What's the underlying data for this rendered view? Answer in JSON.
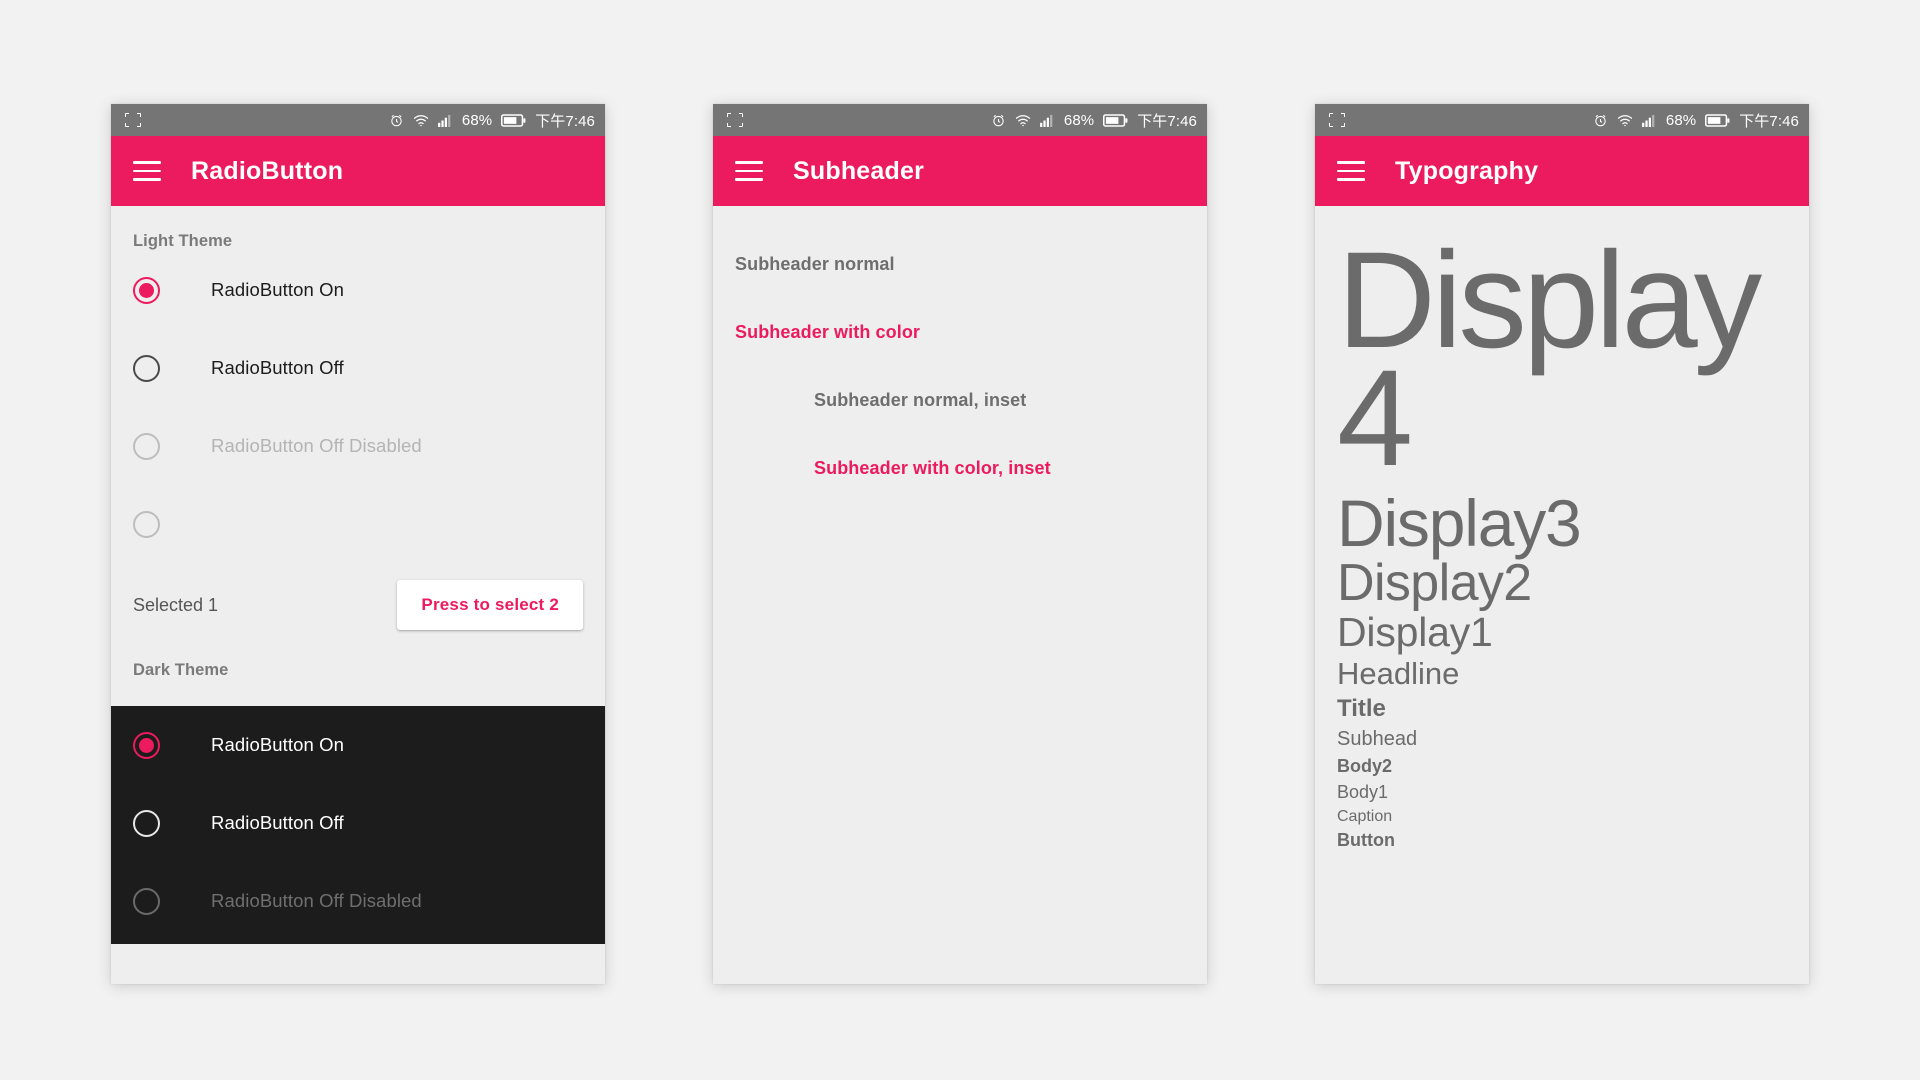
{
  "accent_color": "#EC1A5E",
  "statusbar": {
    "cast_icon": "screen-cast-icon",
    "alarm_icon": "alarm-clock-icon",
    "wifi_icon": "wifi-icon",
    "signal_icon": "cellular-signal-icon",
    "battery_percent": "68%",
    "battery_icon": "battery-icon",
    "time": "下午7:46"
  },
  "phones": [
    {
      "id": "radiobutton",
      "appbar": {
        "menu_icon": "hamburger-menu-icon",
        "title": "RadioButton"
      },
      "light_section_label": "Light Theme",
      "light_items": [
        {
          "label": "RadioButton On",
          "state": "on",
          "disabled": false
        },
        {
          "label": "RadioButton Off",
          "state": "off",
          "disabled": false
        },
        {
          "label": "RadioButton Off Disabled",
          "state": "off",
          "disabled": true
        },
        {
          "label": "",
          "state": "off",
          "disabled": true
        }
      ],
      "selected_text": "Selected 1",
      "press_button_label": "Press to select 2",
      "dark_section_label": "Dark Theme",
      "dark_items": [
        {
          "label": "RadioButton On",
          "state": "on",
          "disabled": false
        },
        {
          "label": "RadioButton Off",
          "state": "off",
          "disabled": false
        },
        {
          "label": "RadioButton Off Disabled",
          "state": "off",
          "disabled": true
        }
      ]
    },
    {
      "id": "subheader",
      "appbar": {
        "menu_icon": "hamburger-menu-icon",
        "title": "Subheader"
      },
      "items": [
        {
          "label": "Subheader normal",
          "color": false,
          "inset": false
        },
        {
          "label": "Subheader with color",
          "color": true,
          "inset": false
        },
        {
          "label": "Subheader normal, inset",
          "color": false,
          "inset": true
        },
        {
          "label": "Subheader with color, inset",
          "color": true,
          "inset": true
        }
      ]
    },
    {
      "id": "typography",
      "appbar": {
        "menu_icon": "hamburger-menu-icon",
        "title": "Typography"
      },
      "samples": [
        {
          "label": "Display4",
          "style": "display4"
        },
        {
          "label": "Display3",
          "style": "display3"
        },
        {
          "label": "Display2",
          "style": "display2"
        },
        {
          "label": "Display1",
          "style": "display1"
        },
        {
          "label": "Headline",
          "style": "headline"
        },
        {
          "label": "Title",
          "style": "title"
        },
        {
          "label": "Subhead",
          "style": "subhead"
        },
        {
          "label": "Body2",
          "style": "body2"
        },
        {
          "label": "Body1",
          "style": "body1"
        },
        {
          "label": "Caption",
          "style": "caption"
        },
        {
          "label": "Button",
          "style": "button"
        }
      ]
    }
  ]
}
